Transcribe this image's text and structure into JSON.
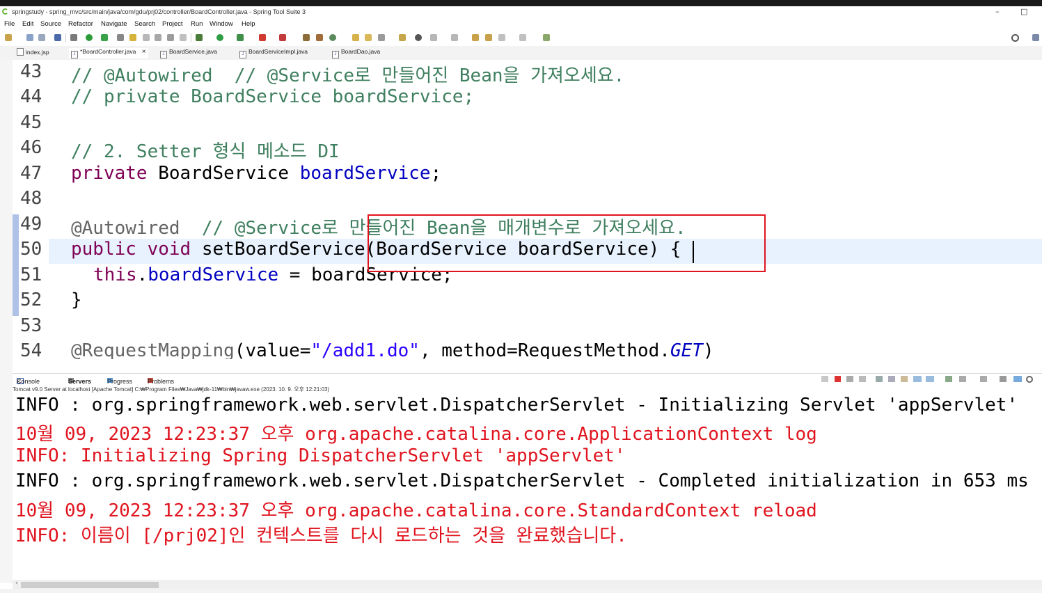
{
  "window": {
    "title": "springstudy - spring_mvc/src/main/java/com/gdu/prj02/controller/BoardController.java - Spring Tool Suite 3",
    "minimize": "–",
    "maximize": "□"
  },
  "menu": [
    "File",
    "Edit",
    "Source",
    "Refactor",
    "Navigate",
    "Search",
    "Project",
    "Run",
    "Window",
    "Help"
  ],
  "tabs": [
    {
      "label": "index.jsp"
    },
    {
      "label": "*BoardController.java",
      "close": "×"
    },
    {
      "label": "BoardService.java"
    },
    {
      "label": "BoardServiceImpl.java"
    },
    {
      "label": "BoardDao.java"
    }
  ],
  "editor": {
    "line_numbers": [
      "43",
      "44",
      "45",
      "46",
      "47",
      "48",
      "49",
      "50",
      "51",
      "52",
      "53",
      "54"
    ],
    "l43": "// @Autowired  // @Service로 만들어진 Bean을 가져오세요.",
    "l44": "// private BoardService boardService;",
    "l46": "// 2. Setter 형식 메소드 DI",
    "l47_kw": "private",
    "l47_type": " BoardService ",
    "l47_field": "boardService",
    "l47_end": ";",
    "l49_ann": "@Autowired",
    "l49_cm": "  // @Service로 만들어진 Bean을 매개변수로 가져오세요.",
    "l50_kw": "public void",
    "l50_rest": " setBoardService(BoardService boardService) {",
    "l51_kw": "this",
    "l51_dot": ".",
    "l51_field": "boardService",
    "l51_rest": " = boardService;",
    "l52": "}",
    "l54_ann": "@RequestMapping",
    "l54_a": "(value=",
    "l54_str": "\"/add1.do\"",
    "l54_b": ", method=RequestMethod.",
    "l54_get": "GET",
    "l54_c": ")"
  },
  "console_tabs": {
    "console": "Console",
    "console_close": "×",
    "servers": "Servers",
    "progress": "Progress",
    "problems": "Problems"
  },
  "server_line": "Tomcat v9.0 Server at localhost [Apache Tomcat] C:₩Program Files₩Java₩jdk-11₩bin₩javaw.exe  (2023. 10. 9. 오후 12:21:03)",
  "console_lines": [
    {
      "text": "INFO : org.springframework.web.servlet.DispatcherServlet - Initializing Servlet 'appServlet'",
      "color": "#000000"
    },
    {
      "text": "10월 09, 2023 12:23:37 오후 org.apache.catalina.core.ApplicationContext log",
      "color": "#e0141e"
    },
    {
      "text": "INFO: Initializing Spring DispatcherServlet 'appServlet'",
      "color": "#e0141e"
    },
    {
      "text": "INFO : org.springframework.web.servlet.DispatcherServlet - Completed initialization in 653 ms",
      "color": "#000000"
    },
    {
      "text": "10월 09, 2023 12:23:37 오후 org.apache.catalina.core.StandardContext reload",
      "color": "#e0141e"
    },
    {
      "text": "INFO: 이름이 [/prj02]인 컨텍스트를 다시 로드하는 것을 완료했습니다.",
      "color": "#e0141e"
    }
  ],
  "colors": {
    "comment": "#3f7f5f",
    "keyword": "#7f0055",
    "field": "#0000c0",
    "string": "#2a00ff",
    "error_red": "#e0141e",
    "highlight_box": "#e0141e"
  }
}
